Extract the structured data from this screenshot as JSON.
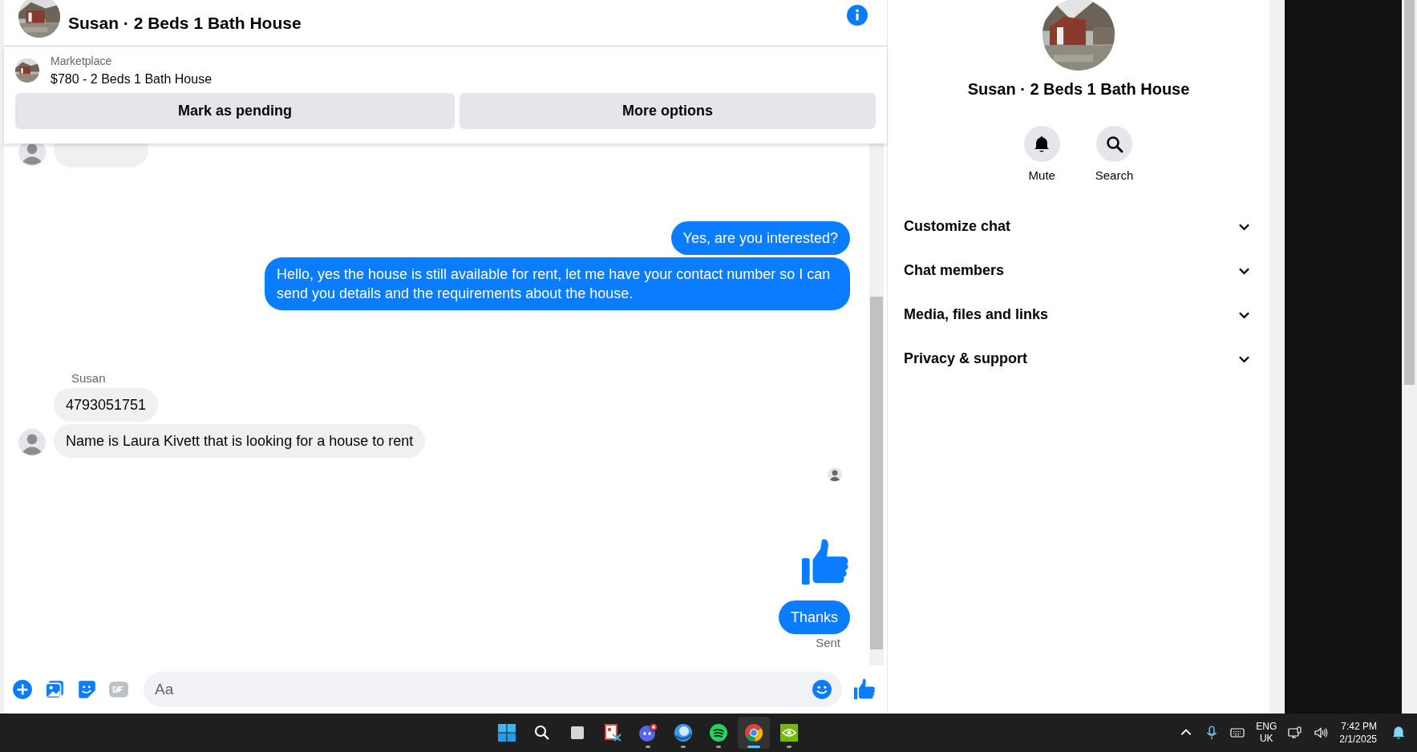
{
  "chat": {
    "title": "Susan · 2 Beds 1 Bath House",
    "listing": {
      "label": "Marketplace",
      "title": "$780 - 2 Beds 1 Bath House"
    },
    "actions": [
      "Mark as pending",
      "More options"
    ],
    "messages": [
      {
        "kind": "clipped",
        "outgoing": false
      },
      {
        "kind": "text",
        "outgoing": true,
        "text": "Yes, are you interested?"
      },
      {
        "kind": "text",
        "outgoing": true,
        "text": "Hello, yes the house is still available for rent, let me have your contact number so I can send you details and the requirements about the house."
      },
      {
        "kind": "sender",
        "text": "Susan"
      },
      {
        "kind": "text",
        "outgoing": false,
        "text": "4793051751",
        "avatar": false
      },
      {
        "kind": "text",
        "outgoing": false,
        "text": "Name is Laura Kivett that is looking for a house to rent",
        "avatar": true
      },
      {
        "kind": "seen"
      },
      {
        "kind": "like"
      },
      {
        "kind": "text",
        "outgoing": true,
        "text": "Thanks"
      },
      {
        "kind": "status",
        "text": "Sent"
      }
    ],
    "composer": {
      "placeholder": "Aa"
    }
  },
  "info": {
    "title": "Susan · 2 Beds 1 Bath House",
    "actions": [
      {
        "kind": "mute",
        "label": "Mute"
      },
      {
        "kind": "search",
        "label": "Search"
      }
    ],
    "sections": [
      {
        "label": "Customize chat",
        "expanded": false
      },
      {
        "label": "Chat members",
        "expanded": false
      },
      {
        "label": "Media, files and links",
        "expanded": false
      },
      {
        "label": "Privacy & support",
        "expanded": false
      }
    ]
  },
  "taskbar": {
    "apps": [
      {
        "kind": "start",
        "running": false,
        "selected": false
      },
      {
        "kind": "search",
        "running": false,
        "selected": false
      },
      {
        "kind": "taskview",
        "running": false,
        "selected": false
      },
      {
        "kind": "snip",
        "running": false,
        "selected": false
      },
      {
        "kind": "discord",
        "running": true,
        "selected": false
      },
      {
        "kind": "orb",
        "running": true,
        "selected": false
      },
      {
        "kind": "spotify",
        "running": true,
        "selected": false
      },
      {
        "kind": "chrome",
        "running": true,
        "selected": true
      },
      {
        "kind": "nvidia",
        "running": true,
        "selected": false
      }
    ],
    "language": [
      "ENG",
      "UK"
    ],
    "time": "7:42 PM",
    "date": "2/1/2025"
  }
}
